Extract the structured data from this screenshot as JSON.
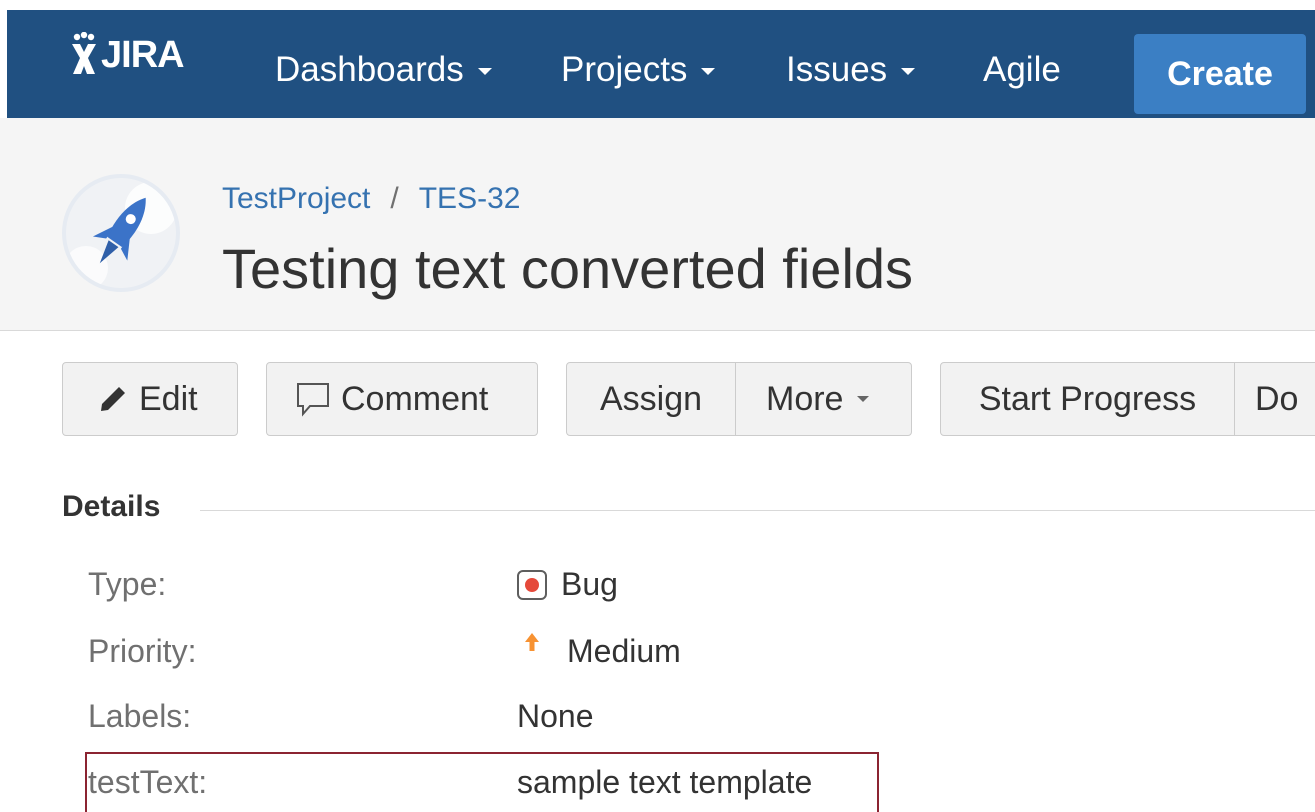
{
  "nav": {
    "logo_text": "JIRA",
    "items": [
      {
        "label": "Dashboards"
      },
      {
        "label": "Projects"
      },
      {
        "label": "Issues"
      },
      {
        "label": "Agile"
      }
    ],
    "create_label": "Create"
  },
  "issue": {
    "project": "TestProject",
    "separator": "/",
    "key": "TES-32",
    "summary": "Testing text converted fields"
  },
  "toolbar": {
    "edit": "Edit",
    "comment": "Comment",
    "assign": "Assign",
    "more": "More",
    "start_progress": "Start Progress",
    "truncated": "Do"
  },
  "details": {
    "heading": "Details",
    "fields": [
      {
        "label": "Type:",
        "value": "Bug",
        "icon": "bug-icon"
      },
      {
        "label": "Priority:",
        "value": "Medium",
        "icon": "priority-medium-icon"
      },
      {
        "label": "Labels:",
        "value": "None"
      },
      {
        "label": "testText:",
        "value": "sample text template"
      }
    ]
  },
  "colors": {
    "nav_bg": "#205081",
    "create_bg": "#3b7fc4",
    "link": "#3572b0",
    "highlight_border": "#8b2431",
    "bug_red": "#e5493a",
    "priority_orange": "#f79232"
  }
}
